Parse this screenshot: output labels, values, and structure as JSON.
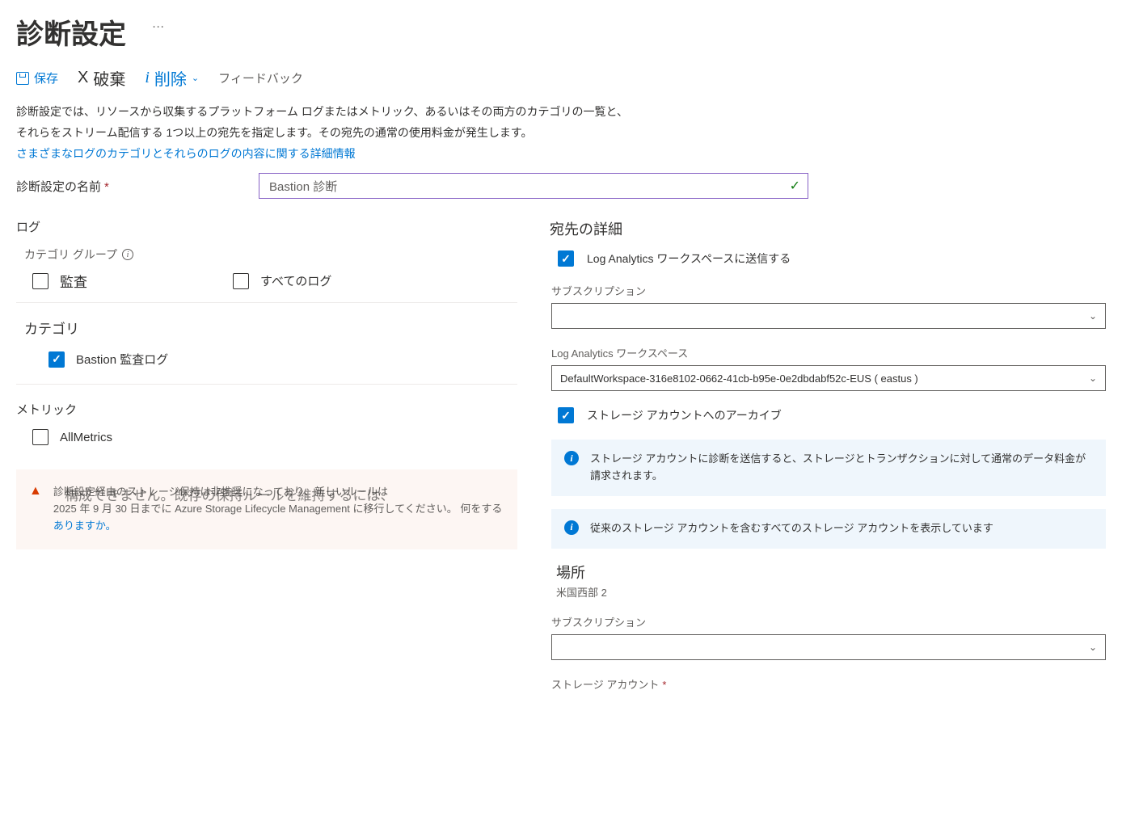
{
  "page": {
    "title": "診断設定",
    "ellipsis": "…"
  },
  "toolbar": {
    "save": "保存",
    "discard_x": "X",
    "discard": "破棄",
    "delete_i": "i",
    "delete": "削除",
    "feedback": "フィードバック"
  },
  "description": {
    "line1": "診断設定では、リソースから収集するプラットフォーム ログまたはメトリック、あるいはその両方のカテゴリの一覧と、",
    "line2": "それらをストリーム配信する 1つ以上の宛先を指定します。その宛先の通常の使用料金が発生します。",
    "link": "さまざまなログのカテゴリとそれらのログの内容に関する詳細情報"
  },
  "name": {
    "label": "診断設定の名前",
    "value": "Bastion 診断"
  },
  "logs": {
    "title": "ログ",
    "category_group_label": "カテゴリ グループ",
    "audit": "監査",
    "all_logs": "すべてのログ",
    "category_title": "カテゴリ",
    "bastion_audit": "Bastion 監査ログ"
  },
  "metrics": {
    "title": "メトリック",
    "all": "AllMetrics"
  },
  "warning": {
    "overlay": "構成できません。既存の保持ルールを維持するには、",
    "text1": "診断設定経由のストレージ保持は非推奨になっており、新しいルールは",
    "text2": "2025 年 9 月 30 日までに Azure Storage Lifecycle Management に移行してください。",
    "link_prefix": "何をする",
    "link": "ありますか。"
  },
  "dest": {
    "title": "宛先の詳細",
    "law_send": "Log Analytics ワークスペースに送信する",
    "subscription_label": "サブスクリプション",
    "law_label": "Log Analytics ワークスペース",
    "law_value": "DefaultWorkspace-316e8102-0662-41cb-b95e-0e2dbdabf52c-EUS ( eastus )",
    "storage_archive": "ストレージ アカウントへのアーカイブ",
    "info1": "ストレージ アカウントに診断を送信すると、ストレージとトランザクションに対して通常のデータ料金が請求されます。",
    "info2": "従来のストレージ アカウントを含むすべてのストレージ アカウントを表示しています",
    "location_title": "場所",
    "location_value": "米国西部 2",
    "storage_account_label": "ストレージ アカウント"
  }
}
